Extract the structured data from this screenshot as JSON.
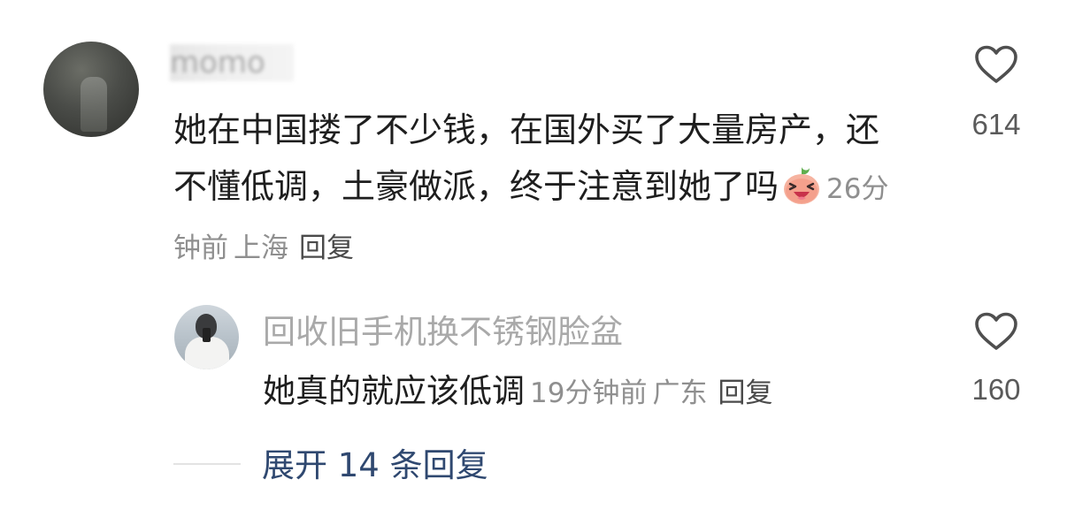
{
  "comment": {
    "username": "momo",
    "text": "她在中国搂了不少钱，在国外买了大量房产，还不懂低调，土豪做派，终于注意到她了吗",
    "emoji": "laughing-peach-emoji",
    "time": "26分钟前",
    "location": "上海",
    "reply_label": "回复",
    "likes": "614"
  },
  "reply": {
    "username": "回收旧手机换不锈钢脸盆",
    "text": "她真的就应该低调",
    "time": "19分钟前",
    "location": "广东",
    "reply_label": "回复",
    "likes": "160"
  },
  "expand_label": "展开 14 条回复",
  "colors": {
    "text": "#1e1e1e",
    "meta": "#8f8f8f",
    "link": "#2f4870",
    "username": "#a9a9a9"
  }
}
